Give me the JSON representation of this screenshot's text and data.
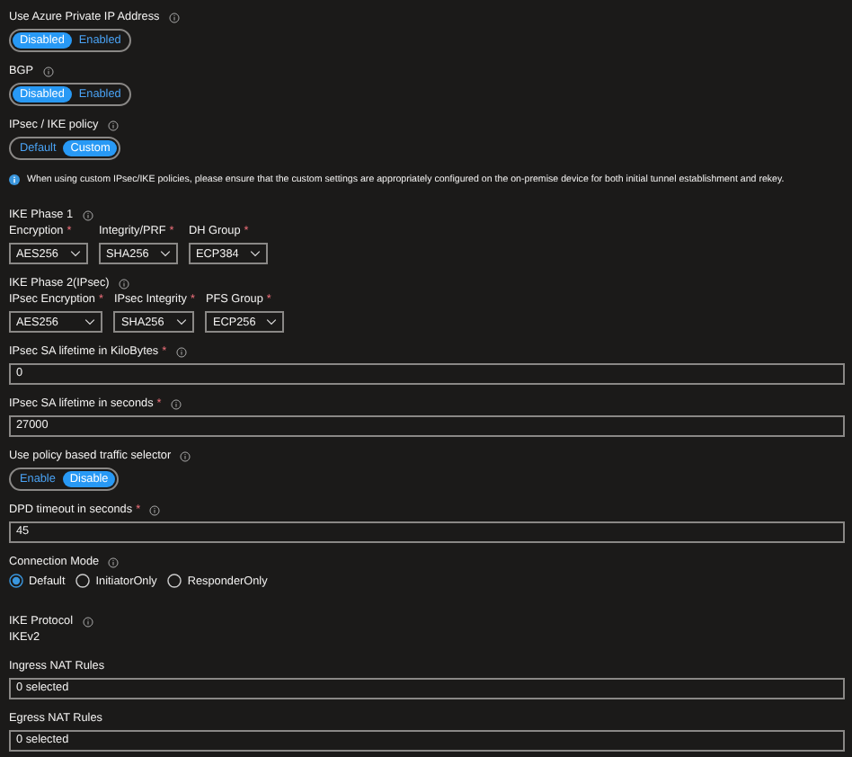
{
  "fields": [
    {
      "kind": "toggle",
      "label": "Use Azure Private IP Address",
      "info": true,
      "options": [
        {
          "label": "Disabled",
          "selected": true
        },
        {
          "label": "Enabled",
          "selected": false
        }
      ]
    },
    {
      "kind": "toggle",
      "label": "BGP",
      "info": true,
      "options": [
        {
          "label": "Disabled",
          "selected": true
        },
        {
          "label": "Enabled",
          "selected": false
        }
      ]
    },
    {
      "kind": "toggle",
      "label": "IPsec / IKE policy",
      "info": true,
      "options": [
        {
          "label": "Default",
          "selected": false
        },
        {
          "label": "Custom",
          "selected": true
        }
      ]
    },
    {
      "kind": "notice",
      "text": "When using custom IPsec/IKE policies, please ensure that the custom settings are appropriately configured on the on-premise device for both initial tunnel establishment and rekey."
    },
    {
      "kind": "selects",
      "label": "IKE Phase 1",
      "info": true,
      "items": [
        {
          "label": "Encryption",
          "mark": "*",
          "value": "AES256"
        },
        {
          "label": "Integrity/PRF",
          "mark": "*",
          "value": "SHA256"
        },
        {
          "label": "DH Group",
          "mark": "*",
          "value": "ECP384"
        }
      ]
    },
    {
      "kind": "selects",
      "label": "IKE Phase 2(IPsec)",
      "info": true,
      "items": [
        {
          "label": "IPsec Encryption",
          "mark": "*",
          "value": "AES256"
        },
        {
          "label": "IPsec Integrity",
          "mark": "*",
          "value": "SHA256"
        },
        {
          "label": "PFS Group",
          "mark": "*",
          "value": "ECP256"
        }
      ]
    },
    {
      "kind": "input",
      "label": "IPsec SA lifetime in KiloBytes",
      "mark": "*",
      "info": true,
      "value": "0"
    },
    {
      "kind": "input",
      "label": "IPsec SA lifetime in seconds",
      "mark": "*",
      "info": true,
      "value": "27000"
    },
    {
      "kind": "toggle",
      "label": "Use policy based traffic selector",
      "info": true,
      "options": [
        {
          "label": "Enable",
          "selected": false
        },
        {
          "label": "Disable",
          "selected": true
        }
      ]
    },
    {
      "kind": "input",
      "label": "DPD timeout in seconds",
      "mark": "*",
      "info": true,
      "value": "45"
    },
    {
      "kind": "radio",
      "label": "Connection Mode",
      "info": true,
      "options": [
        {
          "label": "Default",
          "selected": true
        },
        {
          "label": "InitiatorOnly",
          "selected": false
        },
        {
          "label": "ResponderOnly",
          "selected": false
        }
      ]
    },
    {
      "kind": "readonly",
      "label": "IKE Protocol",
      "info": true,
      "value": "IKEv2"
    },
    {
      "kind": "input",
      "label": "Ingress NAT Rules",
      "value": "0 selected"
    },
    {
      "kind": "input",
      "label": "Egress NAT Rules",
      "value": "0 selected"
    }
  ]
}
